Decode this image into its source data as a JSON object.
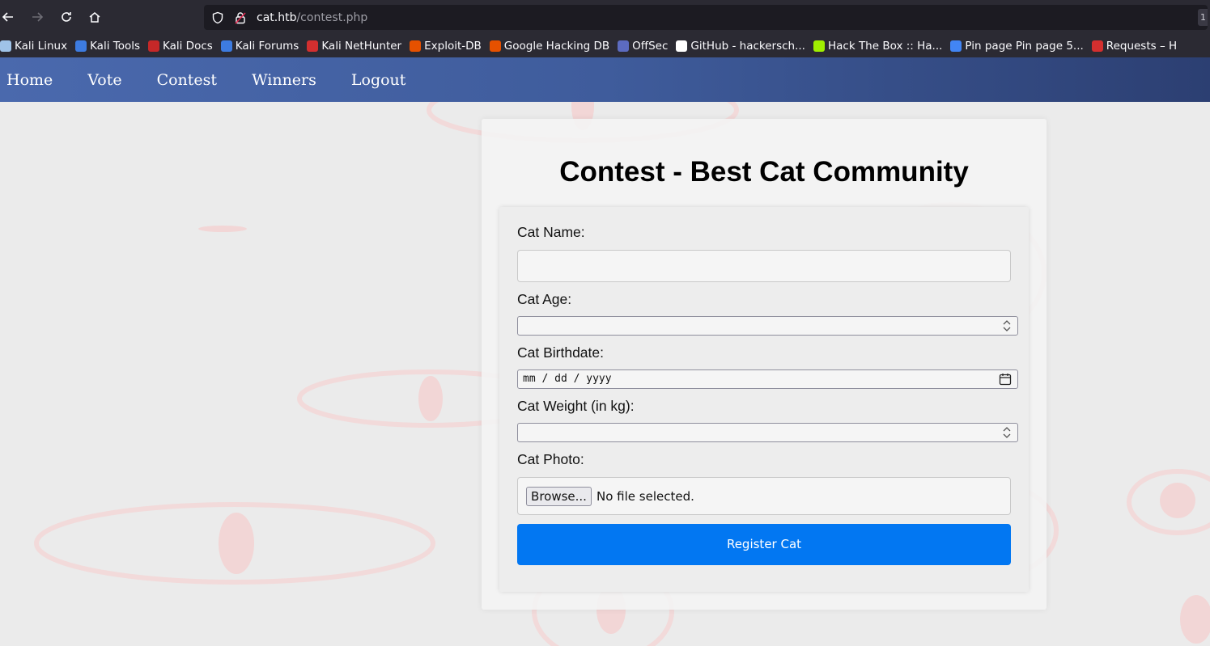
{
  "browser": {
    "url_host": "cat.htb",
    "url_path": "/contest.php",
    "url_end_text": "1",
    "bookmarks": [
      {
        "label": "Kali Linux",
        "color": "#9fc3e8"
      },
      {
        "label": "Kali Tools",
        "color": "#3d7be0"
      },
      {
        "label": "Kali Docs",
        "color": "#c62828"
      },
      {
        "label": "Kali Forums",
        "color": "#3d7be0"
      },
      {
        "label": "Kali NetHunter",
        "color": "#d32f2f"
      },
      {
        "label": "Exploit-DB",
        "color": "#e65100"
      },
      {
        "label": "Google Hacking DB",
        "color": "#e65100"
      },
      {
        "label": "OffSec",
        "color": "#5c6bc0"
      },
      {
        "label": "GitHub - hackersch...",
        "color": "#ffffff"
      },
      {
        "label": "Hack The Box :: Ha...",
        "color": "#9fef00"
      },
      {
        "label": "Pin page Pin page 5...",
        "color": "#4285f4"
      },
      {
        "label": "Requests – H",
        "color": "#d32f2f"
      }
    ]
  },
  "nav": {
    "items": [
      "Home",
      "Vote",
      "Contest",
      "Winners",
      "Logout"
    ]
  },
  "form": {
    "title": "Contest - Best Cat Community",
    "name_label": "Cat Name:",
    "age_label": "Cat Age:",
    "birthdate_label": "Cat Birthdate:",
    "birthdate_placeholder": "mm / dd / yyyy",
    "weight_label": "Cat Weight (in kg):",
    "photo_label": "Cat Photo:",
    "browse_label": "Browse...",
    "no_file_text": "No file selected.",
    "submit_label": "Register Cat"
  },
  "colors": {
    "accent": "#0277f2",
    "nav_start": "#4a69ad",
    "nav_end": "#2c3f72"
  }
}
